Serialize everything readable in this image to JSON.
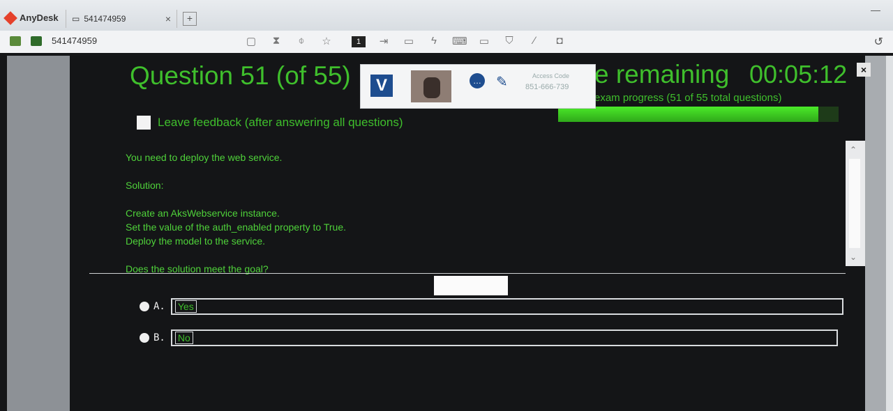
{
  "anydesk": {
    "brand": "AnyDesk",
    "tab_label": "541474959",
    "tab_close": "×",
    "new_tab": "+",
    "window_min": "—",
    "address": "541474959",
    "toolbar_badge": "1"
  },
  "exam": {
    "question_title": "Question 51 (of 55)",
    "time_label": "e remaining",
    "timer": "00:05:12",
    "close": "×",
    "progress_text": "exam progress (51 of 55 total questions)",
    "progress_fraction": 0.927,
    "feedback_label": "Leave feedback (after answering all questions)",
    "body_lines": [
      "You need to deploy the web service.",
      "",
      "Solution:",
      "",
      "Create an AksWebservice instance.",
      "Set the value of the auth_enabled property to True.",
      "Deploy the model to the service.",
      "",
      "Does the solution meet the goal?"
    ],
    "answers": [
      {
        "letter": "A.",
        "text": "Yes"
      },
      {
        "letter": "B.",
        "text": "No"
      }
    ]
  },
  "proctor_popup": {
    "logo_letter": "V",
    "access_code_label": "Access Code",
    "access_code": "851-666-739"
  }
}
